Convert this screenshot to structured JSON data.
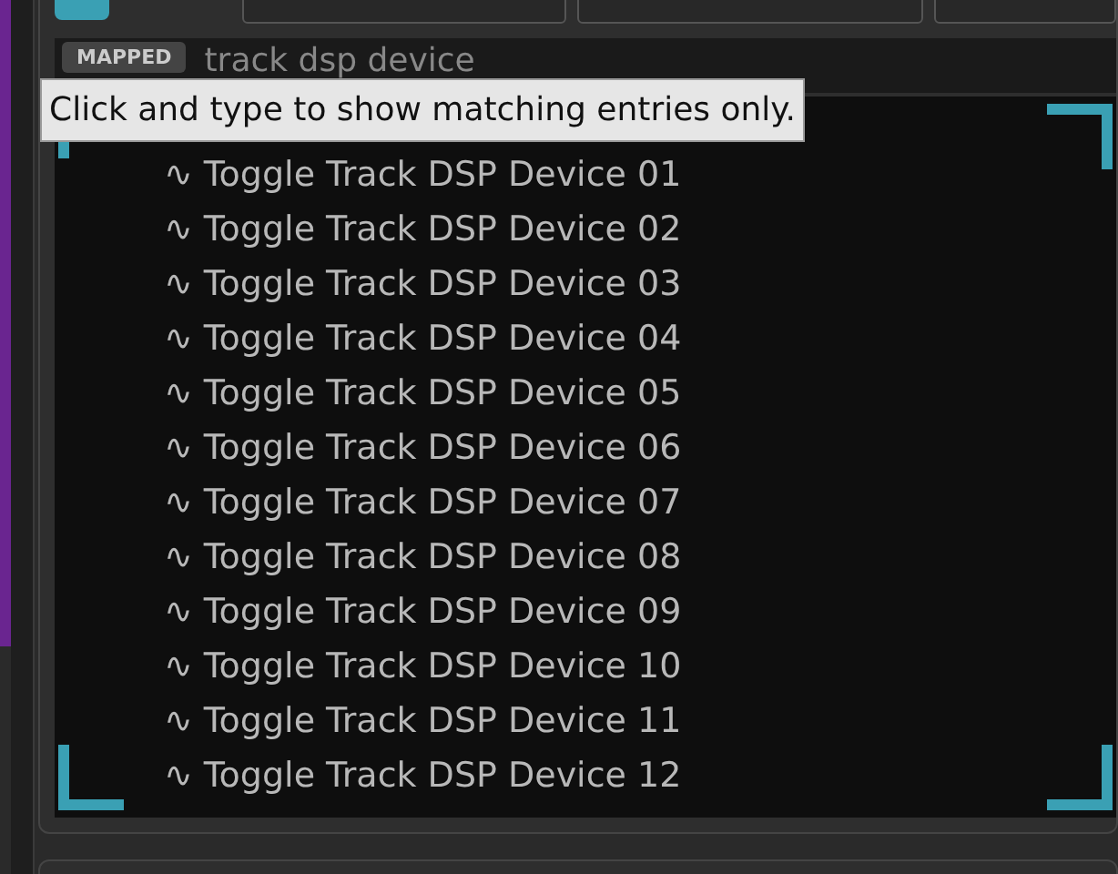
{
  "filter": {
    "badge": "MAPPED",
    "on": false,
    "value": "track dsp device",
    "tooltip": "Click and type to show matching entries only."
  },
  "mappings": [
    {
      "icon": "∿",
      "label": "Toggle Track DSP Device 01"
    },
    {
      "icon": "∿",
      "label": "Toggle Track DSP Device 02"
    },
    {
      "icon": "∿",
      "label": "Toggle Track DSP Device 03"
    },
    {
      "icon": "∿",
      "label": "Toggle Track DSP Device 04"
    },
    {
      "icon": "∿",
      "label": "Toggle Track DSP Device 05"
    },
    {
      "icon": "∿",
      "label": "Toggle Track DSP Device 06"
    },
    {
      "icon": "∿",
      "label": "Toggle Track DSP Device 07"
    },
    {
      "icon": "∿",
      "label": "Toggle Track DSP Device 08"
    },
    {
      "icon": "∿",
      "label": "Toggle Track DSP Device 09"
    },
    {
      "icon": "∿",
      "label": "Toggle Track DSP Device 10"
    },
    {
      "icon": "∿",
      "label": "Toggle Track DSP Device 11"
    },
    {
      "icon": "∿",
      "label": "Toggle Track DSP Device 12"
    }
  ]
}
